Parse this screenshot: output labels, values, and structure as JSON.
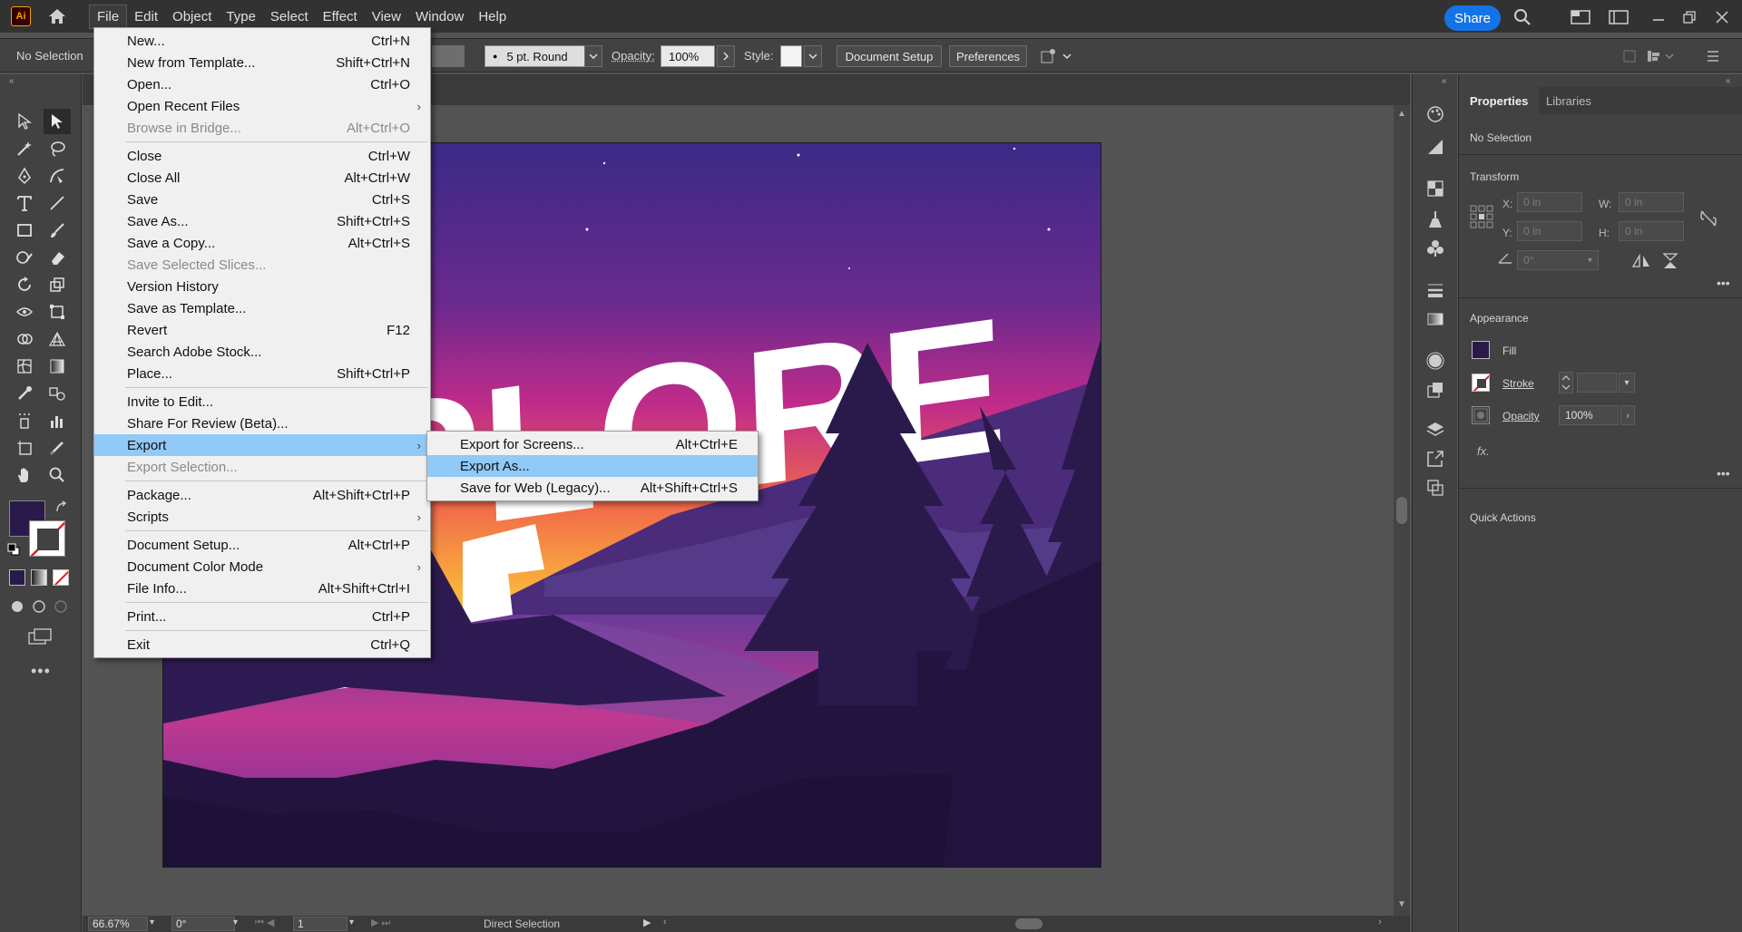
{
  "menubar": {
    "logo": "Ai",
    "items": [
      "File",
      "Edit",
      "Object",
      "Type",
      "Select",
      "Effect",
      "View",
      "Window",
      "Help"
    ],
    "share": "Share"
  },
  "controlbar": {
    "selection": "No Selection",
    "brush": "5 pt. Round",
    "opacity_label": "Opacity:",
    "opacity_value": "100%",
    "style_label": "Style:",
    "document_setup": "Document Setup",
    "preferences": "Preferences"
  },
  "file_menu": [
    {
      "label": "New...",
      "shortcut": "Ctrl+N"
    },
    {
      "label": "New from Template...",
      "shortcut": "Shift+Ctrl+N"
    },
    {
      "label": "Open...",
      "shortcut": "Ctrl+O"
    },
    {
      "label": "Open Recent Files",
      "shortcut": "",
      "submenu": true
    },
    {
      "label": "Browse in Bridge...",
      "shortcut": "Alt+Ctrl+O",
      "disabled": true
    },
    {
      "sep": true
    },
    {
      "label": "Close",
      "shortcut": "Ctrl+W"
    },
    {
      "label": "Close All",
      "shortcut": "Alt+Ctrl+W"
    },
    {
      "label": "Save",
      "shortcut": "Ctrl+S"
    },
    {
      "label": "Save As...",
      "shortcut": "Shift+Ctrl+S"
    },
    {
      "label": "Save a Copy...",
      "shortcut": "Alt+Ctrl+S"
    },
    {
      "label": "Save Selected Slices...",
      "shortcut": "",
      "disabled": true
    },
    {
      "label": "Version History",
      "shortcut": ""
    },
    {
      "label": "Save as Template...",
      "shortcut": ""
    },
    {
      "label": "Revert",
      "shortcut": "F12"
    },
    {
      "label": "Search Adobe Stock...",
      "shortcut": ""
    },
    {
      "label": "Place...",
      "shortcut": "Shift+Ctrl+P"
    },
    {
      "sep": true
    },
    {
      "label": "Invite to Edit...",
      "shortcut": ""
    },
    {
      "label": "Share For Review (Beta)...",
      "shortcut": ""
    },
    {
      "label": "Export",
      "shortcut": "",
      "submenu": true,
      "highlighted": true
    },
    {
      "label": "Export Selection...",
      "shortcut": "",
      "disabled": true
    },
    {
      "sep": true
    },
    {
      "label": "Package...",
      "shortcut": "Alt+Shift+Ctrl+P"
    },
    {
      "label": "Scripts",
      "shortcut": "",
      "submenu": true
    },
    {
      "sep": true
    },
    {
      "label": "Document Setup...",
      "shortcut": "Alt+Ctrl+P"
    },
    {
      "label": "Document Color Mode",
      "shortcut": "",
      "submenu": true
    },
    {
      "label": "File Info...",
      "shortcut": "Alt+Shift+Ctrl+I"
    },
    {
      "sep": true
    },
    {
      "label": "Print...",
      "shortcut": "Ctrl+P"
    },
    {
      "sep": true
    },
    {
      "label": "Exit",
      "shortcut": "Ctrl+Q"
    }
  ],
  "export_submenu": [
    {
      "label": "Export for Screens...",
      "shortcut": "Alt+Ctrl+E"
    },
    {
      "label": "Export As...",
      "shortcut": "",
      "highlighted": true
    },
    {
      "label": "Save for Web (Legacy)...",
      "shortcut": "Alt+Shift+Ctrl+S"
    }
  ],
  "properties": {
    "tab_properties": "Properties",
    "tab_libraries": "Libraries",
    "selection": "No Selection",
    "transform": "Transform",
    "x_label": "X:",
    "x_value": "0 in",
    "y_label": "Y:",
    "y_value": "0 in",
    "w_label": "W:",
    "w_value": "0 in",
    "h_label": "H:",
    "h_value": "0 in",
    "angle_value": "0°",
    "appearance": "Appearance",
    "fill": "Fill",
    "stroke": "Stroke",
    "opacity": "Opacity",
    "opacity_value": "100%",
    "fx": "fx.",
    "quick_actions": "Quick Actions"
  },
  "statusbar": {
    "zoom": "66.67%",
    "rotate": "0°",
    "artboard": "1",
    "tool": "Direct Selection"
  },
  "artwork": {
    "text": "PLORE"
  },
  "colors": {
    "fill": "#2a1a4a",
    "accent": "#1473e6",
    "menu_highlight": "#91c9f7"
  }
}
